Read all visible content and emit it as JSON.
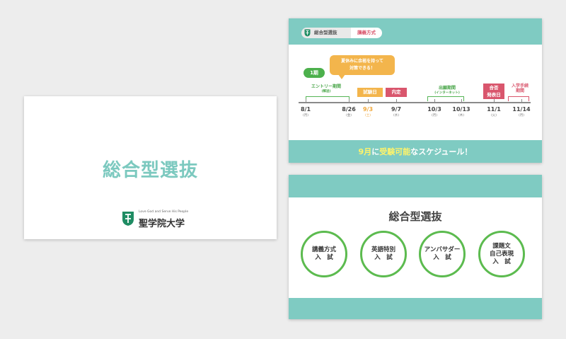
{
  "title_slide": {
    "title": "総合型選抜",
    "logo_motto": "Love God and Serve His People",
    "university_name": "聖学院大学"
  },
  "schedule_slide": {
    "header": {
      "program": "総合型選抜",
      "method": "講義方式"
    },
    "bubble": [
      "夏休みに余裕を持って",
      "対策できる！"
    ],
    "term_badge": "1期",
    "periods": {
      "entry": {
        "label": "エントリー期間",
        "sub": "(郵送)"
      },
      "application": {
        "label": "出願期間",
        "sub": "(インターネット)"
      }
    },
    "events": {
      "exam_day": "試験日",
      "naitei": "内定",
      "pass_announcement": [
        "合否",
        "発表日"
      ],
      "enrollment": [
        "入学手続",
        "期間"
      ]
    },
    "dates": [
      {
        "date": "8/1",
        "day": "(月)"
      },
      {
        "date": "8/26",
        "day": "(金)"
      },
      {
        "date": "9/3",
        "day": "(土)"
      },
      {
        "date": "9/7",
        "day": "(水)"
      },
      {
        "date": "10/3",
        "day": "(月)"
      },
      {
        "date": "10/13",
        "day": "(木)"
      },
      {
        "date": "11/1",
        "day": "(火)"
      },
      {
        "date": "11/14",
        "day": "(月)"
      }
    ],
    "tagline": {
      "part1": "9月",
      "part2": "に",
      "part3": "受験可能",
      "part4": "なスケジュール！"
    }
  },
  "methods_slide": {
    "title": "総合型選抜",
    "methods": [
      "講義方式\n入　試",
      "英語特別\n入　試",
      "アンバサダー\n入　試",
      "課題文\n自己表現\n入　試"
    ]
  },
  "colors": {
    "teal": "#7fcbc2",
    "title_teal": "#7cc9bf",
    "green": "#5cbb4f",
    "orange": "#f3b54c",
    "pink": "#d9566d",
    "yellow": "#fff36a"
  }
}
